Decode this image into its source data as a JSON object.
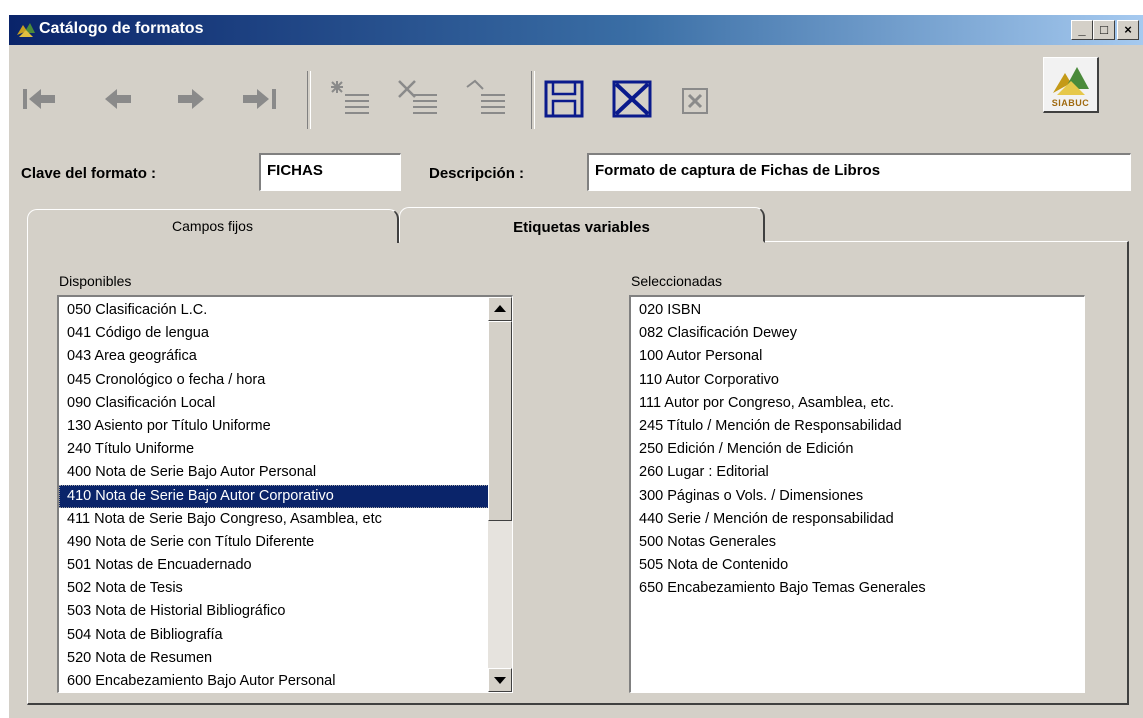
{
  "window": {
    "title": "Catálogo de formatos",
    "minimize_label": "_",
    "maximize_label": "□",
    "close_label": "×"
  },
  "toolbar": {
    "icons": [
      "first-record-icon",
      "previous-record-icon",
      "next-record-icon",
      "last-record-icon",
      "new-record-icon",
      "delete-record-icon",
      "edit-record-icon",
      "save-icon",
      "cancel-icon",
      "close-form-icon"
    ],
    "logo_text": "SIABUC"
  },
  "form": {
    "clave_label": "Clave del formato :",
    "clave_value": "FICHAS",
    "descripcion_label": "Descripción :",
    "descripcion_value": "Formato de captura de Fichas de Libros"
  },
  "tabs": [
    {
      "label": "Campos fijos",
      "active": false
    },
    {
      "label": "Etiquetas variables",
      "active": true
    }
  ],
  "disponibles": {
    "label": "Disponibles",
    "selected_index": 8,
    "items": [
      "050 Clasificación L.C.",
      "041 Código de lengua",
      "043 Area geográfica",
      "045 Cronológico o fecha / hora",
      "090 Clasificación Local",
      "130 Asiento por Título Uniforme",
      "240 Título Uniforme",
      "400 Nota de Serie Bajo Autor Personal",
      "410 Nota de Serie Bajo Autor Corporativo",
      "411 Nota de Serie Bajo Congreso, Asamblea, etc",
      "490 Nota de Serie con Título Diferente",
      "501 Notas de Encuadernado",
      "502 Nota de Tesis",
      "503 Nota de Historial Bibliográfico",
      "504 Nota de Bibliografía",
      "520 Nota de Resumen",
      "600 Encabezamiento Bajo Autor Personal"
    ]
  },
  "seleccionadas": {
    "label": "Seleccionadas",
    "items": [
      "020 ISBN",
      "082 Clasificación Dewey",
      "100 Autor Personal",
      "110 Autor Corporativo",
      "111 Autor por Congreso, Asamblea, etc.",
      "245 Título / Mención de Responsabilidad",
      "250 Edición / Mención de Edición",
      "260 Lugar : Editorial",
      "300 Páginas o Vols. / Dimensiones",
      "440 Serie / Mención de responsabilidad",
      "500 Notas Generales",
      "505 Nota de Contenido",
      "650 Encabezamiento Bajo Temas Generales"
    ]
  },
  "colors": {
    "titlebar": "#0a246a",
    "face": "#d4d0c8",
    "selection": "#0a246a",
    "icon_gray": "#8a8a8a",
    "icon_blue": "#0a1a8c"
  }
}
